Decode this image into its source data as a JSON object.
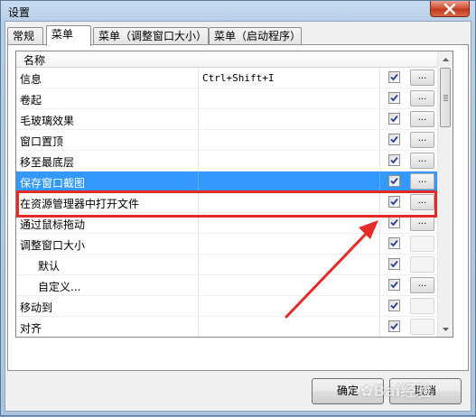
{
  "window": {
    "title": "设置"
  },
  "tabs": [
    {
      "label": "常规",
      "active": false
    },
    {
      "label": "菜单",
      "active": true
    },
    {
      "label": "菜单（调整窗口大小）",
      "active": false
    },
    {
      "label": "菜单（启动程序）",
      "active": false
    }
  ],
  "list": {
    "header": "名称",
    "rows": [
      {
        "name": "信息",
        "shortcut": "Ctrl+Shift+I",
        "checked": true,
        "button_label": "...",
        "button_enabled": true,
        "indent": false,
        "selected": false
      },
      {
        "name": "卷起",
        "shortcut": "",
        "checked": true,
        "button_label": "...",
        "button_enabled": true,
        "indent": false,
        "selected": false
      },
      {
        "name": "毛玻璃效果",
        "shortcut": "",
        "checked": true,
        "button_label": "...",
        "button_enabled": true,
        "indent": false,
        "selected": false
      },
      {
        "name": "窗口置顶",
        "shortcut": "",
        "checked": true,
        "button_label": "...",
        "button_enabled": true,
        "indent": false,
        "selected": false
      },
      {
        "name": "移至最底层",
        "shortcut": "",
        "checked": true,
        "button_label": "...",
        "button_enabled": true,
        "indent": false,
        "selected": false
      },
      {
        "name": "保存窗口截图",
        "shortcut": "",
        "checked": true,
        "button_label": "...",
        "button_enabled": true,
        "indent": false,
        "selected": true
      },
      {
        "name": "在资源管理器中打开文件",
        "shortcut": "",
        "checked": true,
        "button_label": "...",
        "button_enabled": true,
        "indent": false,
        "selected": false
      },
      {
        "name": "通过鼠标拖动",
        "shortcut": "",
        "checked": true,
        "button_label": "...",
        "button_enabled": true,
        "indent": false,
        "selected": false
      },
      {
        "name": "调整窗口大小",
        "shortcut": "",
        "checked": true,
        "button_label": "...",
        "button_enabled": false,
        "indent": false,
        "selected": false
      },
      {
        "name": "默认",
        "shortcut": "",
        "checked": true,
        "button_label": "...",
        "button_enabled": false,
        "indent": true,
        "selected": false
      },
      {
        "name": "自定义...",
        "shortcut": "",
        "checked": true,
        "button_label": "...",
        "button_enabled": true,
        "indent": true,
        "selected": false
      },
      {
        "name": "移动到",
        "shortcut": "",
        "checked": true,
        "button_label": "...",
        "button_enabled": false,
        "indent": false,
        "selected": false
      },
      {
        "name": "对齐",
        "shortcut": "",
        "checked": true,
        "button_label": "...",
        "button_enabled": false,
        "indent": false,
        "selected": false
      }
    ]
  },
  "buttons": {
    "ok": "确定",
    "cancel": "取消"
  },
  "watermark": {
    "text": "Bai经验"
  },
  "colors": {
    "selection": "#3399ff",
    "annotation": "#e52a2a"
  }
}
